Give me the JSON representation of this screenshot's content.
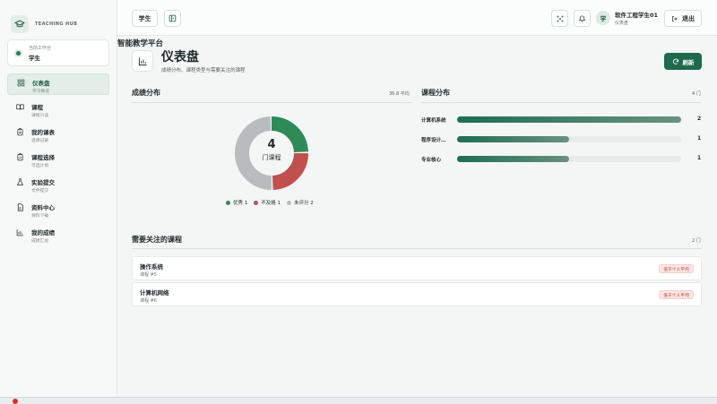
{
  "brand": {
    "eyebrow": "TEACHING HUB",
    "name": "智能教学平台"
  },
  "workspace": {
    "label": "当前工作台",
    "value": "学生"
  },
  "sidebar": {
    "items": [
      {
        "label": "仪表盘",
        "sub": "学习概览",
        "icon": "dashboard-icon",
        "active": true
      },
      {
        "label": "课程",
        "sub": "课程只读",
        "icon": "book-icon",
        "active": false
      },
      {
        "label": "我的课表",
        "sub": "选课记录",
        "icon": "clipboard-icon",
        "active": false
      },
      {
        "label": "课程选择",
        "sub": "可选计划",
        "icon": "clipboard-check-icon",
        "active": false
      },
      {
        "label": "实验提交",
        "sub": "文件提交",
        "icon": "flask-icon",
        "active": false
      },
      {
        "label": "资料中心",
        "sub": "资料下载",
        "icon": "file-icon",
        "active": false
      },
      {
        "label": "我的成绩",
        "sub": "成绩汇总",
        "icon": "bar-chart-icon",
        "active": false
      }
    ]
  },
  "topbar": {
    "role_button": "学生",
    "logout": "退出"
  },
  "user": {
    "avatar": "学",
    "name": "软件工程学生01",
    "page": "仪表盘"
  },
  "page": {
    "title": "仪表盘",
    "subtitle": "成绩分布、课程类型与需要关注的课程",
    "refresh": "刷新"
  },
  "grade_section": {
    "title": "成绩分布",
    "meta": "36.8 平均"
  },
  "course_section": {
    "title": "课程分布",
    "meta": "4 门"
  },
  "attention_section": {
    "title": "需要关注的课程",
    "meta": "2 门"
  },
  "donut_center": {
    "value": "4",
    "label": "门课程"
  },
  "colors": {
    "primary": "#1f6a4b",
    "excellent": "#2e8b57",
    "failed": "#c0504d",
    "unrated": "#b8bcbf"
  },
  "chart_data": [
    {
      "type": "pie",
      "categories": [
        "优秀",
        "不及格",
        "未评分"
      ],
      "values": [
        1,
        1,
        2
      ],
      "legend": [
        {
          "label": "优秀 1",
          "color": "#2e8b57"
        },
        {
          "label": "不及格 1",
          "color": "#c0504d"
        },
        {
          "label": "未评分 2",
          "color": "#b8bcbf"
        }
      ]
    },
    {
      "type": "bar",
      "categories": [
        "计算机系统",
        "程序设计…",
        "专业核心"
      ],
      "values": [
        2,
        1,
        1
      ],
      "value_labels": [
        "2",
        "1",
        "1"
      ],
      "xlim": [
        0,
        2
      ]
    }
  ],
  "attention_courses": [
    {
      "name": "操作系统",
      "id": "课程 #5",
      "badge": "低于个人平均"
    },
    {
      "name": "计算机网络",
      "id": "课程 #6",
      "badge": "低于个人平均"
    }
  ]
}
